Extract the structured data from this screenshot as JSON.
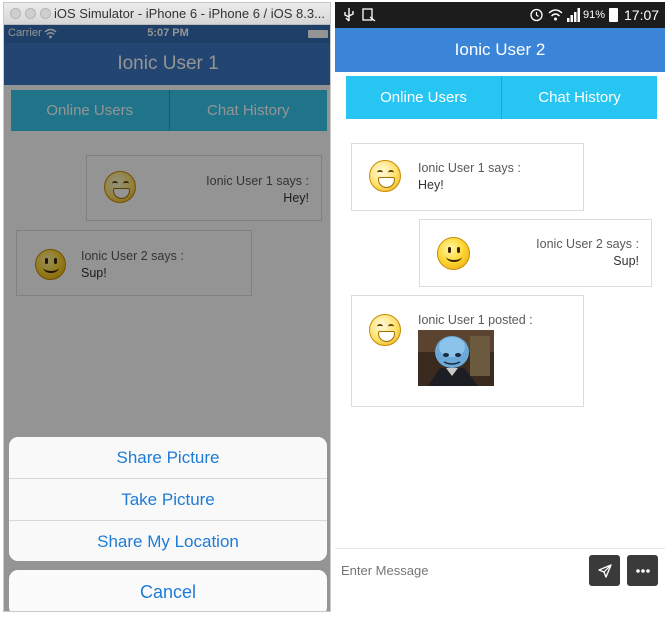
{
  "left": {
    "window_title": "iOS Simulator - iPhone 6 - iPhone 6 / iOS 8.3...",
    "status": {
      "carrier": "Carrier",
      "time": "5:07 PM"
    },
    "header_title": "Ionic User 1",
    "tabs": [
      "Online Users",
      "Chat History"
    ],
    "messages": [
      {
        "who": "Ionic User 1 says :",
        "text": "Hey!"
      },
      {
        "who": "Ionic User 2 says :",
        "text": "Sup!"
      }
    ],
    "action_sheet": {
      "options": [
        "Share Picture",
        "Take Picture",
        "Share My Location"
      ],
      "cancel": "Cancel"
    }
  },
  "right": {
    "status": {
      "battery": "91%",
      "time": "17:07"
    },
    "header_title": "Ionic User 2",
    "tabs": [
      "Online Users",
      "Chat History"
    ],
    "messages": [
      {
        "who": "Ionic User 1 says :",
        "text": "Hey!"
      },
      {
        "who": "Ionic User 2 says :",
        "text": "Sup!"
      },
      {
        "who": "Ionic User 1 posted :",
        "image": "megamind-picture"
      }
    ],
    "input_placeholder": "Enter Message",
    "icons": {
      "send": "send-icon",
      "more": "more-icon"
    }
  },
  "colors": {
    "ios_header": "#3b78c4",
    "android_header": "#3b85d9",
    "tab_bar": "#26c5f2",
    "action_text": "#1e7bd6"
  }
}
